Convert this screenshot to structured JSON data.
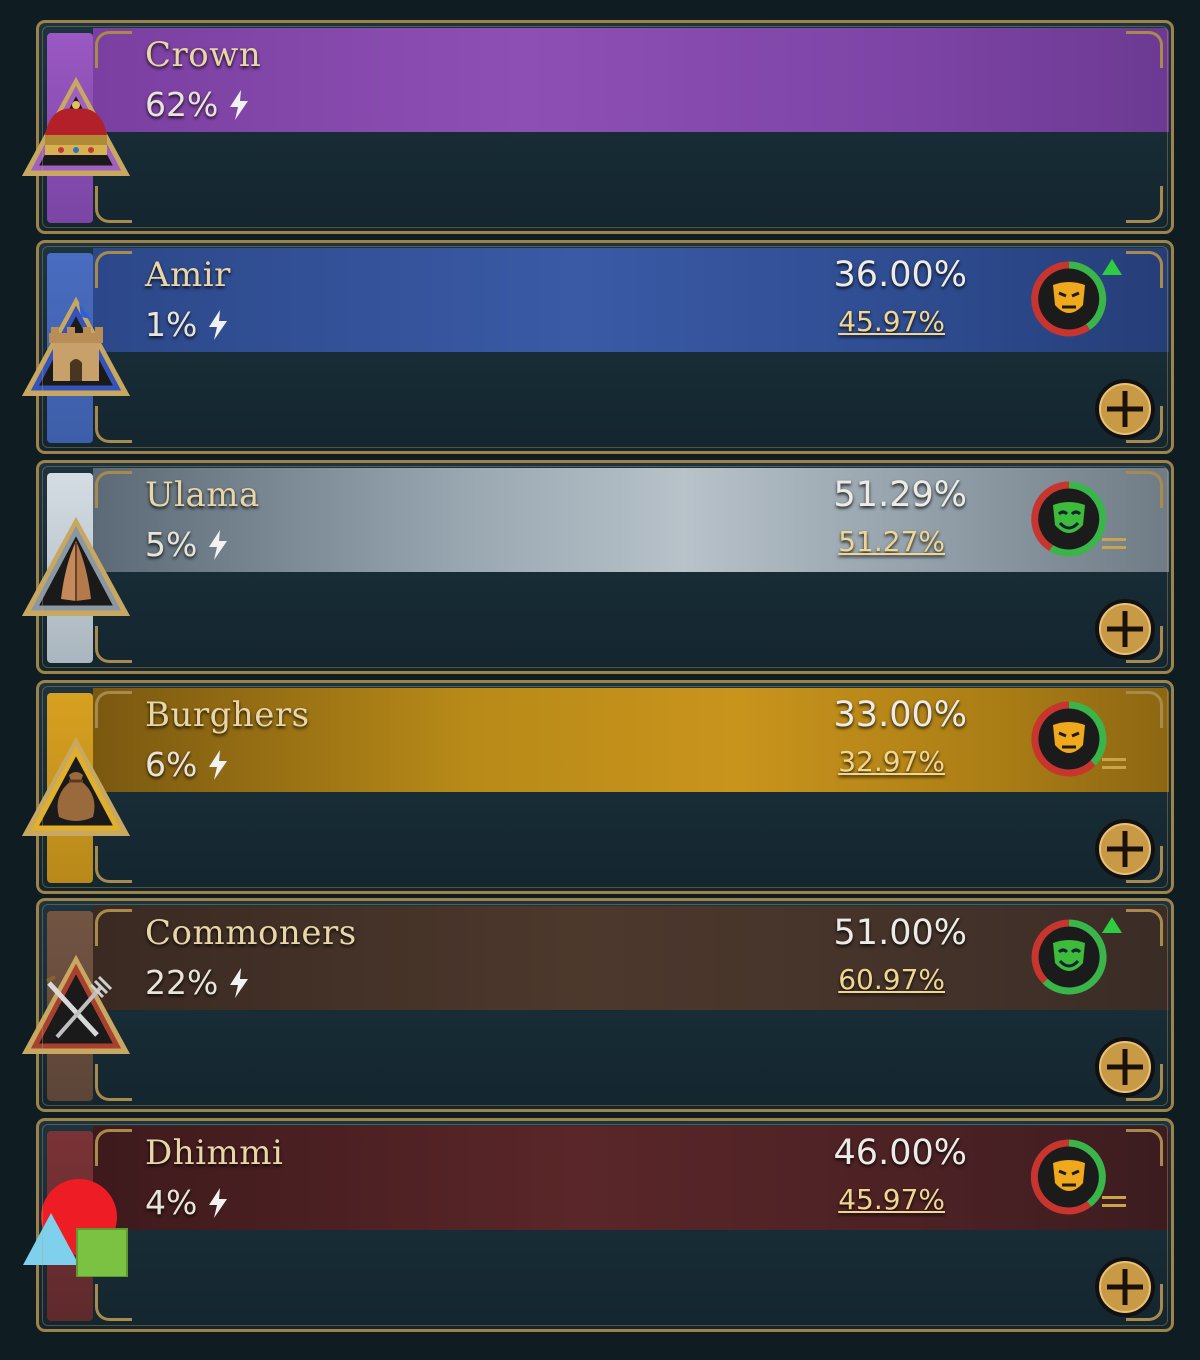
{
  "estates": [
    {
      "name": "Crown",
      "power": "62%",
      "influence": "",
      "loyalty": "",
      "mood": "",
      "trend": "",
      "icon": "crown-icon",
      "color": "#8e4fb4"
    },
    {
      "name": "Amir",
      "power": "1%",
      "influence": "36.00%",
      "loyalty": "45.97%",
      "mood": "neutral",
      "trend": "up",
      "icon": "castle-tower-icon",
      "color": "#3d5ea8"
    },
    {
      "name": "Ulama",
      "power": "5%",
      "influence": "51.29%",
      "loyalty": "51.27%",
      "mood": "happy",
      "trend": "equal",
      "icon": "praying-hands-icon",
      "color": "#b9c4cc"
    },
    {
      "name": "Burghers",
      "power": "6%",
      "influence": "33.00%",
      "loyalty": "32.97%",
      "mood": "neutral",
      "trend": "equal",
      "icon": "coin-sack-icon",
      "color": "#c9941c"
    },
    {
      "name": "Commoners",
      "power": "22%",
      "influence": "51.00%",
      "loyalty": "60.97%",
      "mood": "happy",
      "trend": "up",
      "icon": "pitchfork-sword-icon",
      "color": "#6b4c3a"
    },
    {
      "name": "Dhimmi",
      "power": "4%",
      "influence": "46.00%",
      "loyalty": "45.97%",
      "mood": "neutral",
      "trend": "equal",
      "icon": "shapes-icon",
      "color": "#6e2e30"
    }
  ],
  "colors": {
    "frame_gold": "#9d8347",
    "mood_neutral": "#f0a81c",
    "mood_happy": "#3dbb3a",
    "ring_green": "#39b54a",
    "ring_red": "#c8352f",
    "trend_up": "#2ecc40"
  }
}
